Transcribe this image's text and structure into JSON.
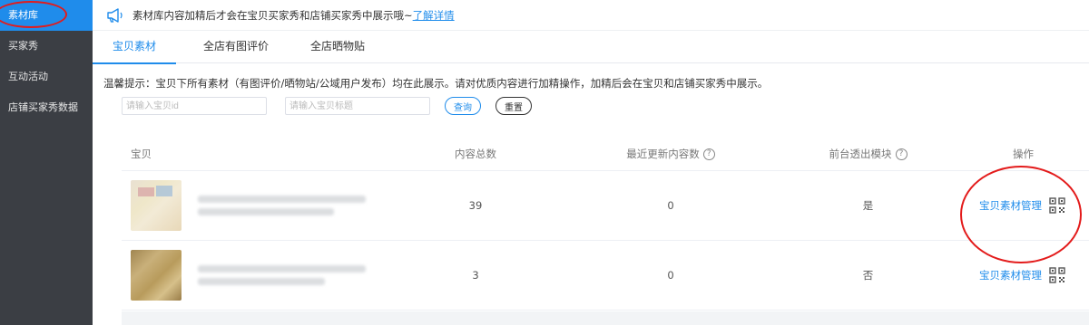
{
  "sidebar": {
    "items": [
      {
        "label": "素材库",
        "active": true
      },
      {
        "label": "买家秀",
        "active": false
      },
      {
        "label": "互动活动",
        "active": false
      },
      {
        "label": "店铺买家秀数据",
        "active": false
      }
    ]
  },
  "notice": {
    "text": "素材库内容加精后才会在宝贝买家秀和店铺买家秀中展示哦~",
    "link": "了解详情",
    "icon": "megaphone-icon"
  },
  "tabs": [
    {
      "label": "宝贝素材",
      "active": true
    },
    {
      "label": "全店有图评价",
      "active": false
    },
    {
      "label": "全店晒物贴",
      "active": false
    }
  ],
  "tip": "温馨提示：宝贝下所有素材（有图评价/晒物站/公域用户发布）均在此展示。请对优质内容进行加精操作，加精后会在宝贝和店铺买家秀中展示。",
  "filters": {
    "id_placeholder": "请输入宝贝id",
    "title_placeholder": "请输入宝贝标题",
    "search_label": "查询",
    "reset_label": "重置"
  },
  "table": {
    "headers": {
      "item": "宝贝",
      "total": "内容总数",
      "recent": "最近更新内容数",
      "module": "前台透出模块",
      "action": "操作"
    },
    "rows": [
      {
        "total": "39",
        "recent": "0",
        "module": "是",
        "action": "宝贝素材管理"
      },
      {
        "total": "3",
        "recent": "0",
        "module": "否",
        "action": "宝贝素材管理"
      }
    ]
  },
  "colors": {
    "accent": "#1f8ceb",
    "sidebar_bg": "#3b3e44",
    "annotation": "#e31b1b"
  }
}
